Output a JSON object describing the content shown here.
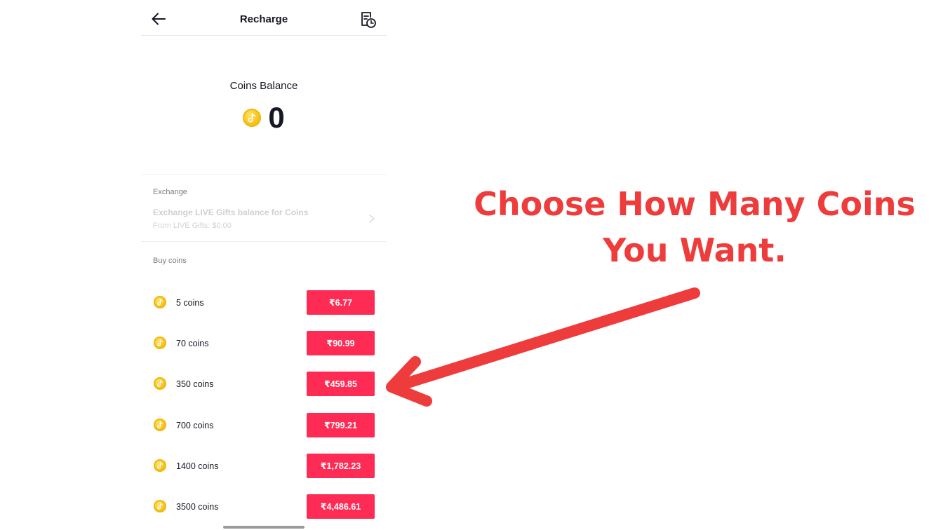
{
  "header": {
    "title": "Recharge",
    "back_icon": "arrow-left-icon",
    "history_icon": "transaction-history-icon"
  },
  "balance": {
    "label": "Coins Balance",
    "value": "0",
    "coin_icon": "tiktok-coin-icon"
  },
  "exchange": {
    "section_label": "Exchange",
    "title": "Exchange LIVE Gifts balance for Coins",
    "subtitle": "From LIVE Gifts: $0.00",
    "chevron_icon": "chevron-right-icon"
  },
  "buy": {
    "section_label": "Buy coins",
    "packages": [
      {
        "coins": "5 coins",
        "price": "₹6.77"
      },
      {
        "coins": "70 coins",
        "price": "₹90.99"
      },
      {
        "coins": "350 coins",
        "price": "₹459.85"
      },
      {
        "coins": "700 coins",
        "price": "₹799.21"
      },
      {
        "coins": "1400 coins",
        "price": "₹1,782.23"
      },
      {
        "coins": "3500 coins",
        "price": "₹4,486.61"
      }
    ]
  },
  "annotation": {
    "line1": "Choose How Many Coins",
    "line2": "You Want.",
    "color": "#ee3b3b"
  },
  "colors": {
    "accent": "#fe2c55",
    "coin": "#f7c21a",
    "text": "#161823"
  }
}
